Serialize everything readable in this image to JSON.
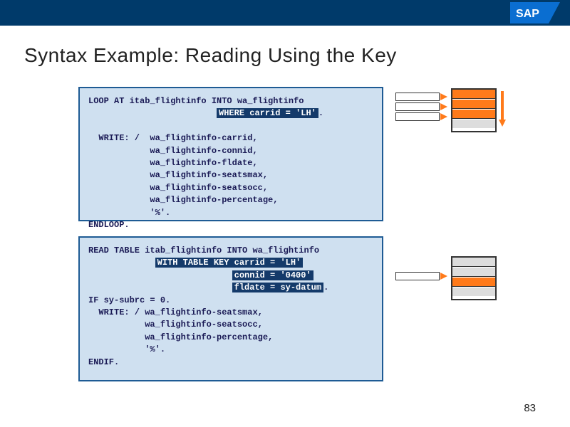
{
  "header": {
    "logo_text": "SAP"
  },
  "title": "Syntax Example: Reading Using the Key",
  "code1": {
    "l1": "LOOP AT itab_flightinfo INTO wa_flightinfo",
    "hl1": "WHERE carrid = 'LH'",
    "dot1": ".",
    "l2": "  WRITE: /  wa_flightinfo-carrid,",
    "l3": "            wa_flightinfo-connid,",
    "l4": "            wa_flightinfo-fldate,",
    "l5": "            wa_flightinfo-seatsmax,",
    "l6": "            wa_flightinfo-seatsocc,",
    "l7": "            wa_flightinfo-percentage,",
    "l8": "            '%'.",
    "l9": "ENDLOOP."
  },
  "code2": {
    "l1": "READ TABLE itab_flightinfo INTO wa_flightinfo",
    "hl1": "WITH TABLE KEY carrid = 'LH'",
    "hl2": "connid = '0400'",
    "hl3": "fldate = sy-datum",
    "dot1": ".",
    "l2": "IF sy-subrc = 0.",
    "l3": "  WRITE: / wa_flightinfo-seatsmax,",
    "l4": "           wa_flightinfo-seatsocc,",
    "l5": "           wa_flightinfo-percentage,",
    "l6": "           '%'.",
    "l7": "ENDIF."
  },
  "page_number": "83"
}
